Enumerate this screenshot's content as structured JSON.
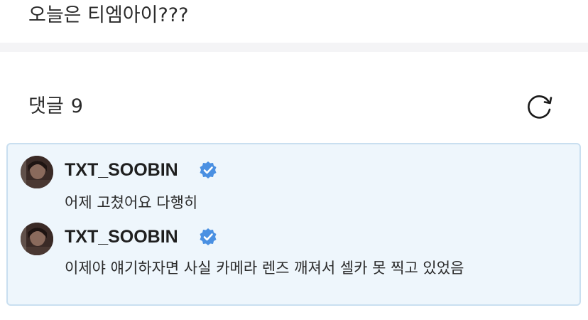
{
  "post": {
    "text": "오늘은 티엠아이???"
  },
  "comments_section": {
    "title": "댓글",
    "count": "9",
    "refresh_icon": "refresh-icon"
  },
  "replies": [
    {
      "author": "TXT_SOOBIN",
      "verified": true,
      "text": "어제 고쳤어요 다행히"
    },
    {
      "author": "TXT_SOOBIN",
      "verified": true,
      "text": "이제야 얘기하자면 사실 카메라 렌즈 깨져서 셀카 못 찍고 있었음"
    }
  ],
  "colors": {
    "highlight_bg": "#eef6fc",
    "highlight_border": "#c9dff0",
    "verified_blue": "#4a90e2",
    "divider": "#f4f4f6"
  }
}
